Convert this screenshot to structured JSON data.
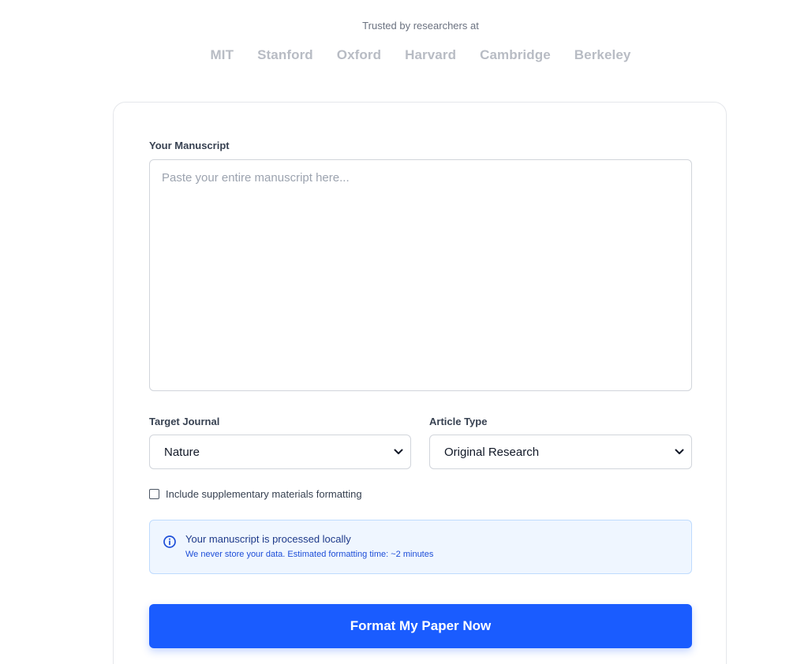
{
  "trusted": {
    "heading": "Trusted by researchers at",
    "institutions": [
      "MIT",
      "Stanford",
      "Oxford",
      "Harvard",
      "Cambridge",
      "Berkeley"
    ]
  },
  "form": {
    "manuscript_label": "Your Manuscript",
    "manuscript_placeholder": "Paste your entire manuscript here...",
    "manuscript_value": "",
    "journal_label": "Target Journal",
    "journal_value": "Nature",
    "article_type_label": "Article Type",
    "article_type_value": "Original Research",
    "supplementary_label": "Include supplementary materials formatting",
    "supplementary_checked": false
  },
  "notice": {
    "title": "Your manuscript is processed locally",
    "subtitle": "We never store your data. Estimated formatting time: ~2 minutes",
    "icon": "info-icon",
    "color": "#1d4ed8"
  },
  "cta": {
    "label": "Format My Paper Now",
    "color": "#1a5cff"
  }
}
